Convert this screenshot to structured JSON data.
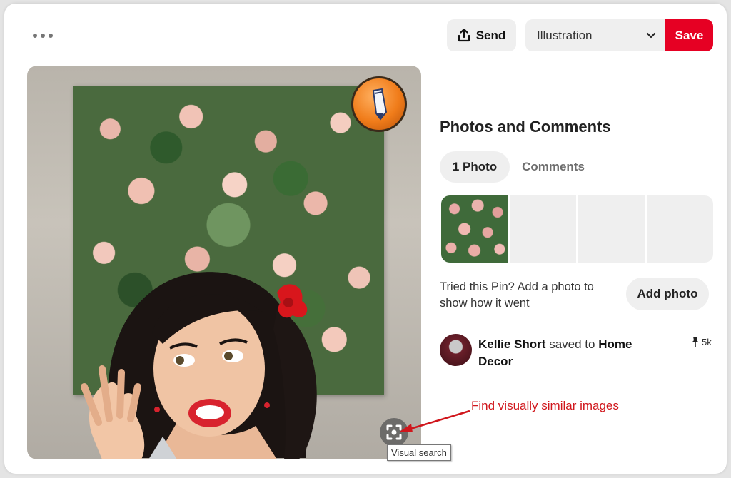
{
  "header": {
    "more_icon": "more-dots-icon",
    "send_label": "Send",
    "board_selected": "Illustration",
    "save_label": "Save"
  },
  "image": {
    "visual_search_tooltip": "Visual search"
  },
  "annotation": {
    "text": "Find visually similar images",
    "color": "#d0161c"
  },
  "photos_comments": {
    "title": "Photos and Comments",
    "tabs": [
      {
        "label": "1 Photo",
        "active": true
      },
      {
        "label": "Comments",
        "active": false
      }
    ],
    "tried_text": "Tried this Pin? Add a photo to show how it went",
    "add_photo_label": "Add photo"
  },
  "saved_by": {
    "user": "Kellie Short",
    "action": "saved to",
    "board": "Home Decor",
    "count": "5k"
  },
  "colors": {
    "brand_red": "#e60023",
    "button_gray": "#efefef"
  }
}
